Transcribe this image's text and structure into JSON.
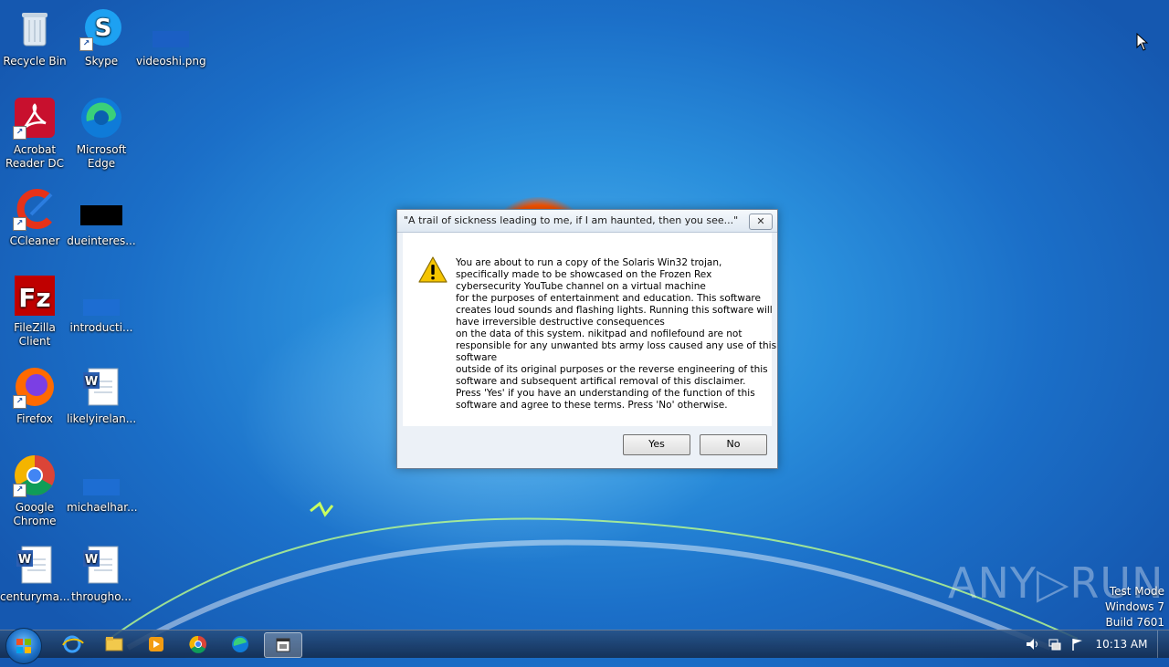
{
  "desktop": {
    "icons": [
      {
        "label": "Recycle Bin"
      },
      {
        "label": "Skype"
      },
      {
        "label": "videoshi.png"
      },
      {
        "label": "Acrobat Reader DC"
      },
      {
        "label": "Microsoft Edge"
      },
      {
        "label": "CCleaner"
      },
      {
        "label": "dueinteres..."
      },
      {
        "label": "FileZilla Client"
      },
      {
        "label": "introducti..."
      },
      {
        "label": "Firefox"
      },
      {
        "label": "likelyirelan..."
      },
      {
        "label": "Google Chrome"
      },
      {
        "label": "michaelhar..."
      },
      {
        "label": "centuryma..."
      },
      {
        "label": "througho..."
      }
    ]
  },
  "dialog": {
    "title": "\"A trail of sickness leading to me, if I am haunted, then you see...\" (S...",
    "close_label": "✕",
    "message_lines": [
      "You are about to run a copy of the Solaris Win32 trojan,",
      "specifically made to be showcased on the Frozen Rex",
      "cybersecurity YouTube channel on a virtual machine",
      "for the purposes of entertainment and education. This software",
      "creates loud sounds and flashing lights. Running this software will",
      "have irreversible destructive consequences",
      "on the data of this system. nikitpad and nofilefound are not",
      "responsible for any unwanted bts army loss caused any use of this",
      "software",
      "outside of its original purposes or the reverse engineering of this",
      "software and subsequent artifical removal of this disclaimer.",
      "Press 'Yes' if you have an understanding of the function of this",
      "software and agree to these terms. Press 'No' otherwise."
    ],
    "yes_label": "Yes",
    "no_label": "No"
  },
  "taskbar": {
    "clock": "10:13 AM",
    "pinned": [
      "internet-explorer-icon",
      "file-explorer-icon",
      "media-player-icon",
      "chrome-icon",
      "edge-icon",
      "app-window-icon"
    ]
  },
  "watermark": "ANY▷RUN",
  "test_mode": [
    "Test Mode",
    "Windows 7",
    "Build 7601"
  ],
  "colors": {
    "accent": "#1b6fc8",
    "warning": "#f5c400"
  }
}
